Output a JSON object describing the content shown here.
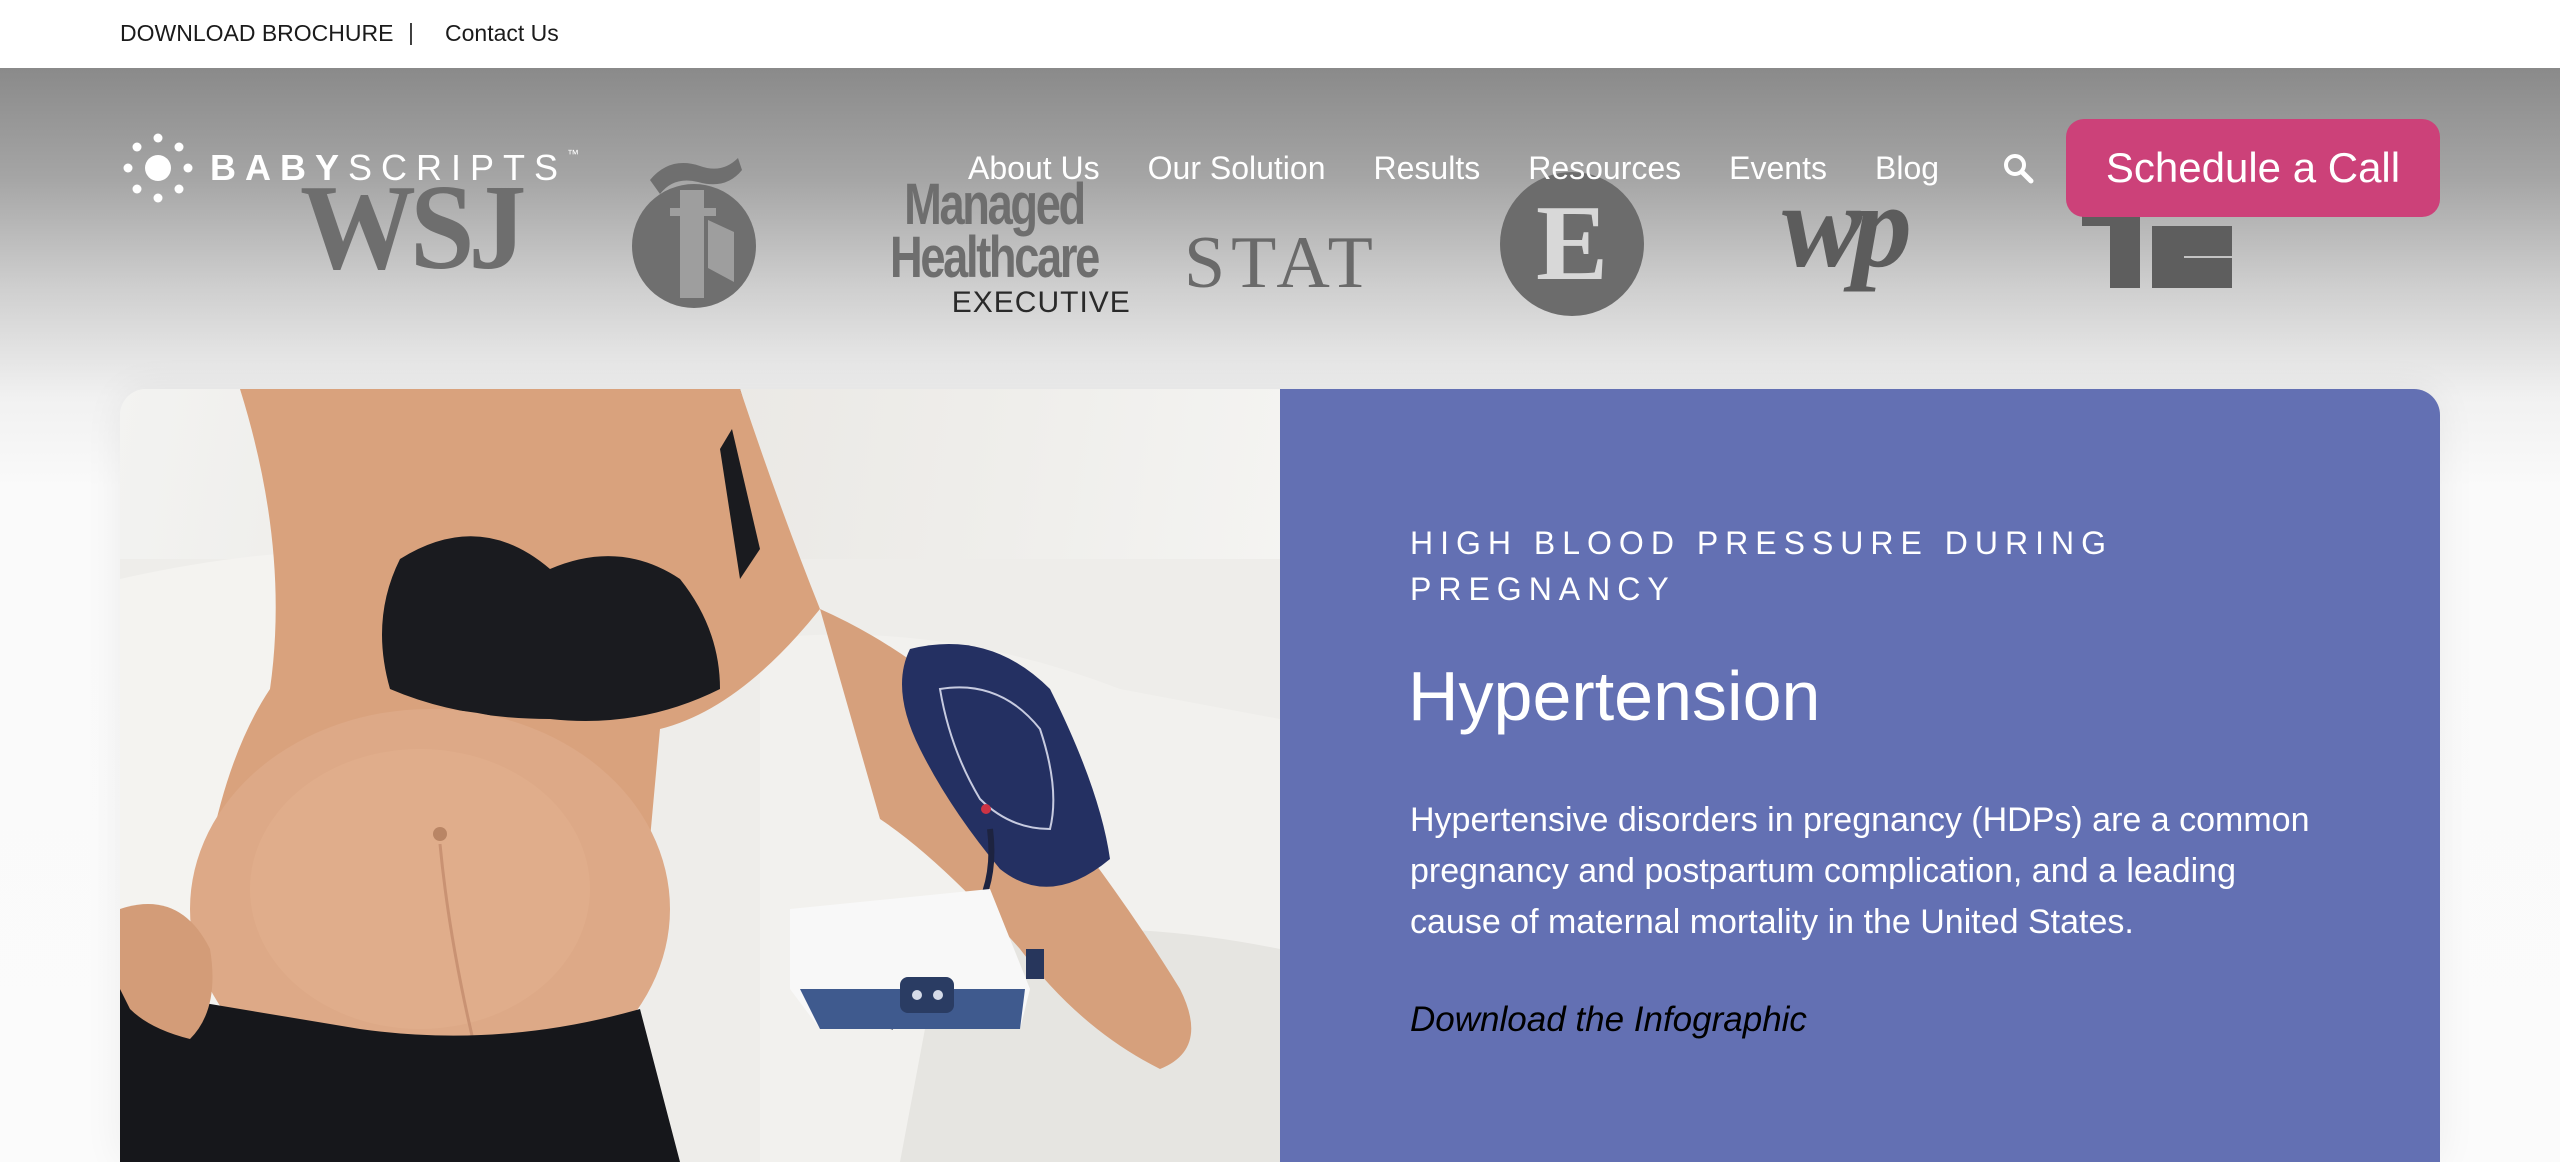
{
  "topbar": {
    "download_brochure": "DOWNLOAD BROCHURE",
    "separator": "|",
    "contact_us": "Contact Us"
  },
  "press_logos": {
    "wsj": "WSJ",
    "managed_healthcare_line1": "Managed",
    "managed_healthcare_line2": "Healthcare",
    "managed_healthcare_line3": "EXECUTIVE",
    "stat": "STAT",
    "engadget": "E",
    "washington_post": "wp"
  },
  "header": {
    "brand_bold": "BABY",
    "brand_light": "SCRIPTS",
    "brand_tm": "™",
    "nav": [
      "About Us",
      "Our Solution",
      "Results",
      "Resources",
      "Events",
      "Blog"
    ],
    "cta_label": "Schedule a Call"
  },
  "feature": {
    "eyebrow": "HIGH BLOOD PRESSURE DURING PREGNANCY",
    "title": "Hypertension",
    "body": "Hypertensive disorders in pregnancy (HDPs) are a common pregnancy and postpartum complication, and a leading cause of maternal mortality in the United States.",
    "link": "Download the Infographic"
  },
  "colors": {
    "accent_cta": "#cc4179",
    "panel_bg": "#6370b3",
    "nav_text": "#ffffff"
  },
  "icons": [
    "search-icon",
    "babyscripts-logo-icon"
  ]
}
